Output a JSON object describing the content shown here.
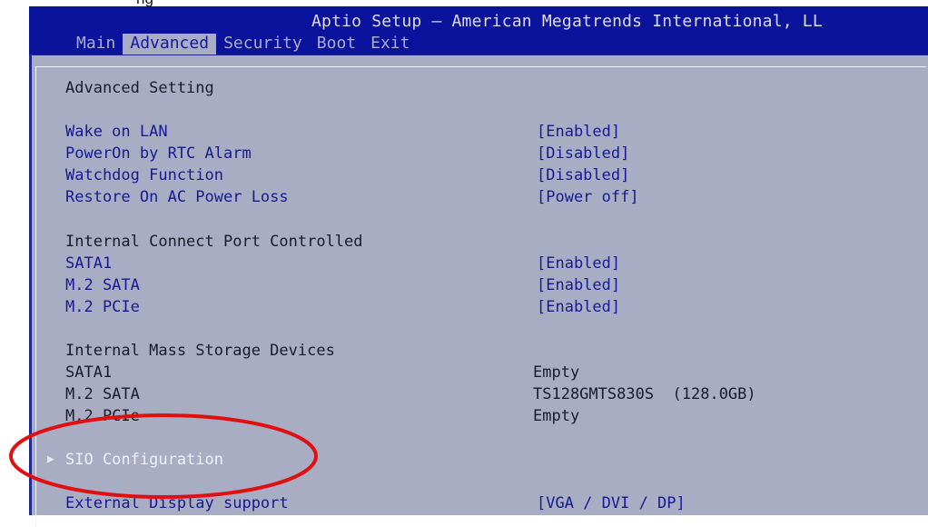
{
  "caption": "ng",
  "header": {
    "title": "Aptio Setup – American Megatrends International, LL",
    "tabs": [
      "Main",
      "Advanced",
      "Security",
      "Boot",
      "Exit"
    ],
    "active_tab": "Advanced"
  },
  "section": {
    "title": "Advanced Setting"
  },
  "power_items": [
    {
      "label": "Wake on LAN",
      "value": "[Enabled]"
    },
    {
      "label": "PowerOn by RTC Alarm",
      "value": "[Disabled]"
    },
    {
      "label": "Watchdog Function",
      "value": "[Disabled]"
    },
    {
      "label": "Restore On AC Power Loss",
      "value": "[Power off]"
    }
  ],
  "port_group": {
    "title": "Internal Connect Port Controlled",
    "items": [
      {
        "label": "SATA1",
        "value": "[Enabled]"
      },
      {
        "label": "M.2 SATA",
        "value": "[Enabled]"
      },
      {
        "label": "M.2 PCIe",
        "value": "[Enabled]"
      }
    ]
  },
  "storage_group": {
    "title": "Internal Mass Storage Devices",
    "items": [
      {
        "label": "SATA1",
        "value": "Empty"
      },
      {
        "label": "M.2 SATA",
        "value": "TS128GMTS830S  (128.0GB)"
      },
      {
        "label": "M.2 PCIe",
        "value": "Empty"
      }
    ]
  },
  "submenu": {
    "label": "SIO Configuration",
    "icon": "submenu-arrow-icon"
  },
  "display_item": {
    "label": "External Display support",
    "value": "[VGA / DVI / DP]"
  },
  "annotation": {
    "shape": "ellipse",
    "color": "#e01010"
  }
}
